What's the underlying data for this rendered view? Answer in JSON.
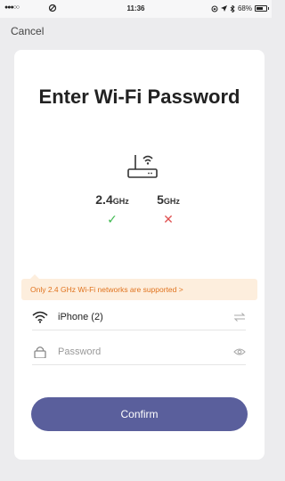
{
  "status_bar": {
    "signal": "●●●○○",
    "time": "11:36",
    "battery": "68%"
  },
  "nav": {
    "cancel_label": "Cancel"
  },
  "title": "Enter Wi-Fi Password",
  "bands": [
    {
      "freq": "2.4",
      "unit": "GHz",
      "supported": true,
      "mark": "✓"
    },
    {
      "freq": "5",
      "unit": "GHz",
      "supported": false,
      "mark": "✕"
    }
  ],
  "notice": "Only 2.4 GHz Wi-Fi networks are supported >",
  "network": {
    "ssid": "iPhone (2)"
  },
  "password": {
    "placeholder": "Password",
    "value": ""
  },
  "confirm_label": "Confirm",
  "colors": {
    "accent": "#5a5f9c",
    "ok": "#3fb950",
    "error": "#e05252",
    "notice_bg": "#fdeedd",
    "notice_text": "#e0731e"
  }
}
